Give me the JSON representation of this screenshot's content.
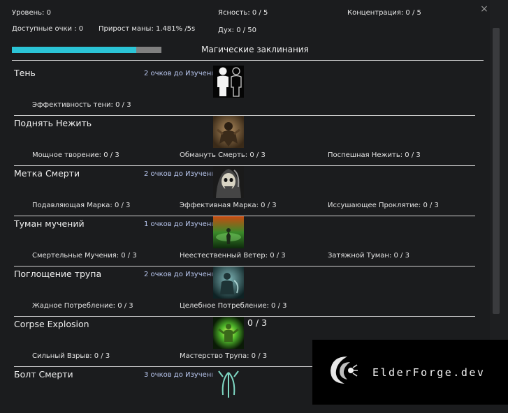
{
  "stats": {
    "level": "Уровень: 0",
    "clarity": "Ясность: 0 / 5",
    "concentration": "Концентрация: 0 / 5",
    "points": "Доступные очки : 0",
    "mana_regen": "Прирост маны: 1.481% /5s",
    "spirit": "Дух: 0 / 50"
  },
  "progress": {
    "fraction": 0.83,
    "color": "#2bc4d6"
  },
  "section_title": "Магические заклинания",
  "close_label": "×",
  "spells": [
    {
      "name": "Тень",
      "requirement": "2 очков до Изучения",
      "level": "",
      "icon": "shadow-spell-icon",
      "talents": [
        "Эффективность тени: 0 / 3",
        "",
        ""
      ]
    },
    {
      "name": "Поднять Нежить",
      "requirement": "",
      "level": "",
      "icon": "raise-undead-icon",
      "talents": [
        "Мощное творение: 0 / 3",
        "Обмануть Смерть: 0 / 3",
        "Поспешная Нежить: 0 / 3"
      ]
    },
    {
      "name": "Метка Смерти",
      "requirement": "2 очков до Изучения",
      "level": "",
      "icon": "death-mark-icon",
      "talents": [
        "Подавляющая Марка: 0 / 3",
        "Эффективная Марка: 0 / 3",
        "Иссушающее Проклятие: 0 / 3"
      ]
    },
    {
      "name": "Туман мучений",
      "requirement": "1 очков до Изучения",
      "level": "",
      "icon": "torment-fog-icon",
      "talents": [
        "Смертельные Мучения: 0 / 3",
        "Неестественный Ветер: 0 / 3",
        "Затяжной Туман: 0 / 3"
      ]
    },
    {
      "name": "Поглощение трупа",
      "requirement": "2 очков до Изучения",
      "level": "",
      "icon": "corpse-absorb-icon",
      "talents": [
        "Жадное Потребление: 0 / 3",
        "Целебное Потребление: 0 / 3",
        ""
      ]
    },
    {
      "name": "Corpse Explosion",
      "requirement": "",
      "level": "0 / 3",
      "icon": "corpse-explosion-icon",
      "talents": [
        "Сильный Взрыв: 0 / 3",
        "Мастерство Трупа: 0 / 3",
        ""
      ]
    },
    {
      "name": "Болт Смерти",
      "requirement": "3 очков до Изучения",
      "level": "",
      "icon": "death-bolt-icon",
      "talents": [
        "",
        "",
        ""
      ]
    }
  ],
  "brand": {
    "text": "ElderForge.dev",
    "icon": "elderforge-logo-icon"
  }
}
